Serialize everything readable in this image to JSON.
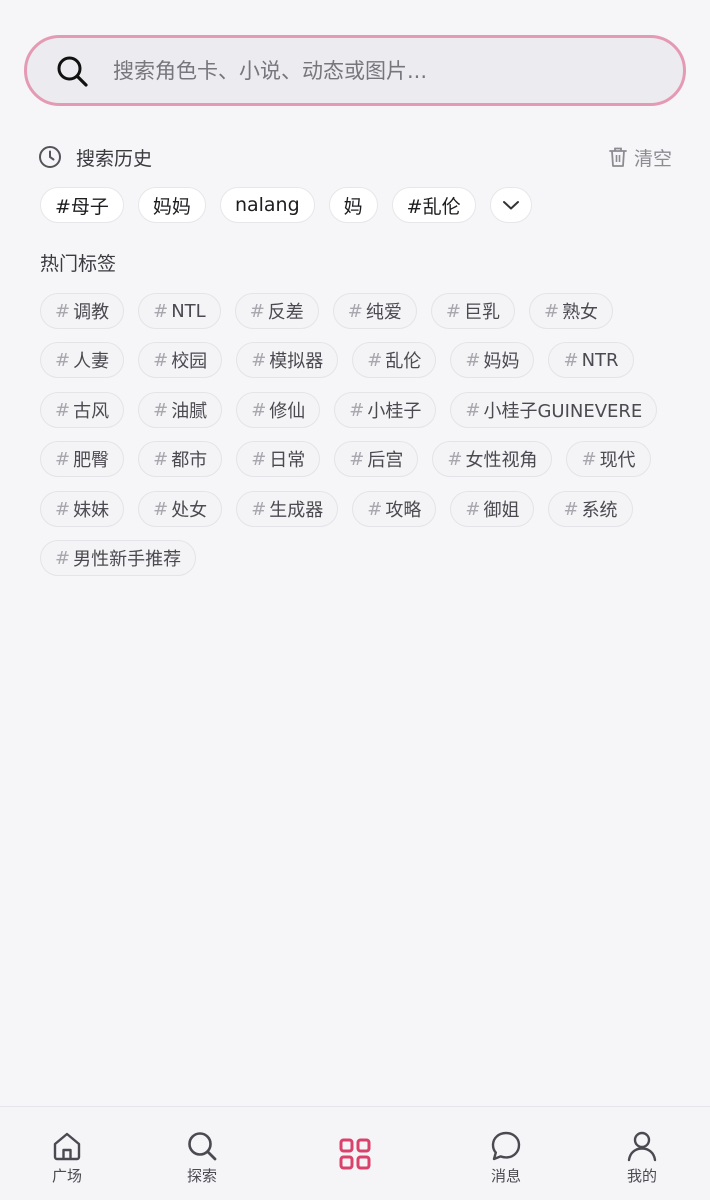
{
  "search": {
    "placeholder": "搜索角色卡、小说、动态或图片...",
    "value": ""
  },
  "history": {
    "title": "搜索历史",
    "clear_label": "清空",
    "items": [
      "#母子",
      "妈妈",
      "nalang",
      "妈",
      "#乱伦"
    ]
  },
  "hot": {
    "title": "热门标签",
    "hash": "#",
    "rows": [
      [
        "调教",
        "NTL",
        "反差",
        "纯爱",
        "巨乳",
        "熟女"
      ],
      [
        "人妻",
        "校园",
        "模拟器",
        "乱伦",
        "妈妈",
        "NTR"
      ],
      [
        "古风",
        "油腻",
        "修仙",
        "小桂子",
        "小桂子GUINEVERE"
      ],
      [
        "肥臀",
        "都市",
        "日常",
        "后宫",
        "女性视角",
        "现代"
      ],
      [
        "妹妹",
        "处女",
        "生成器",
        "攻略",
        "御姐",
        "系统"
      ],
      [
        "男性新手推荐"
      ]
    ]
  },
  "nav": {
    "accent": "#d9436b",
    "items": [
      {
        "label": "广场",
        "icon": "home-icon"
      },
      {
        "label": "探索",
        "icon": "search-icon"
      },
      {
        "label": "",
        "icon": "grid-icon",
        "active": true
      },
      {
        "label": "消息",
        "icon": "chat-bubble-icon"
      },
      {
        "label": "我的",
        "icon": "person-icon"
      }
    ]
  }
}
